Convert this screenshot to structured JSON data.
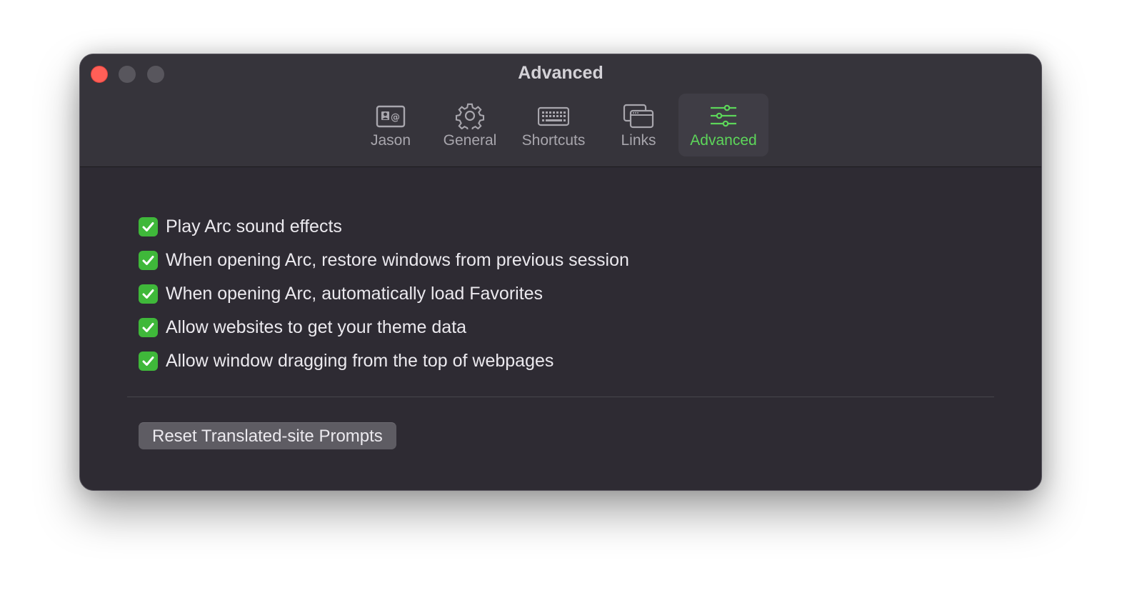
{
  "window": {
    "title": "Advanced"
  },
  "tabs": [
    {
      "label": "Jason",
      "icon": "contact-card-icon",
      "active": false
    },
    {
      "label": "General",
      "icon": "gear-icon",
      "active": false
    },
    {
      "label": "Shortcuts",
      "icon": "keyboard-icon",
      "active": false
    },
    {
      "label": "Links",
      "icon": "windows-icon",
      "active": false
    },
    {
      "label": "Advanced",
      "icon": "sliders-icon",
      "active": true
    }
  ],
  "settings": [
    {
      "label": "Play Arc sound effects",
      "checked": true
    },
    {
      "label": "When opening Arc, restore windows from previous session",
      "checked": true
    },
    {
      "label": "When opening Arc, automatically load Favorites",
      "checked": true
    },
    {
      "label": "Allow websites to get your theme data",
      "checked": true
    },
    {
      "label": "Allow window dragging from the top of webpages",
      "checked": true
    }
  ],
  "reset_button": {
    "label": "Reset Translated-site Prompts"
  },
  "colors": {
    "accent": "#5dd65a",
    "checkbox": "#3fb83a",
    "close": "#ff5f57"
  }
}
